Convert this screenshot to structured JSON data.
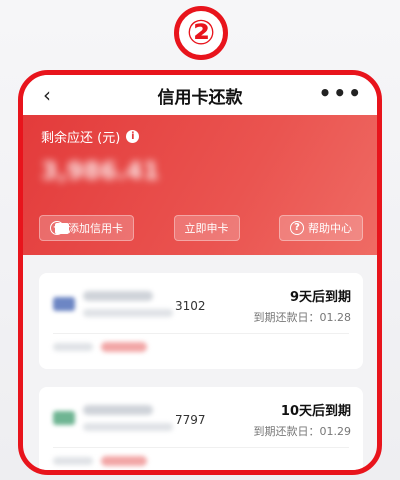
{
  "step_marker": "②",
  "nav": {
    "back_icon": "‹",
    "title": "信用卡还款",
    "more_icon": "•••"
  },
  "hero": {
    "label": "剩余应还 (元)",
    "amount": "3,986.41",
    "actions": [
      {
        "label": "添加信用卡",
        "icon": "plus-circle-icon"
      },
      {
        "label": "立即申卡",
        "icon": "card-icon"
      },
      {
        "label": "帮助中心",
        "icon": "help-circle-icon"
      }
    ]
  },
  "cards": [
    {
      "tail": "3102",
      "due_in": "9天后到期",
      "due_date": "到期还款日：01.28",
      "logo_color": "#6d86c4"
    },
    {
      "tail": "7797",
      "due_in": "10天后到期",
      "due_date": "到期还款日：01.29",
      "logo_color": "#6fb593"
    }
  ],
  "colors": {
    "accent_red": "#e8141c",
    "hero_red": "#e33b3b"
  }
}
